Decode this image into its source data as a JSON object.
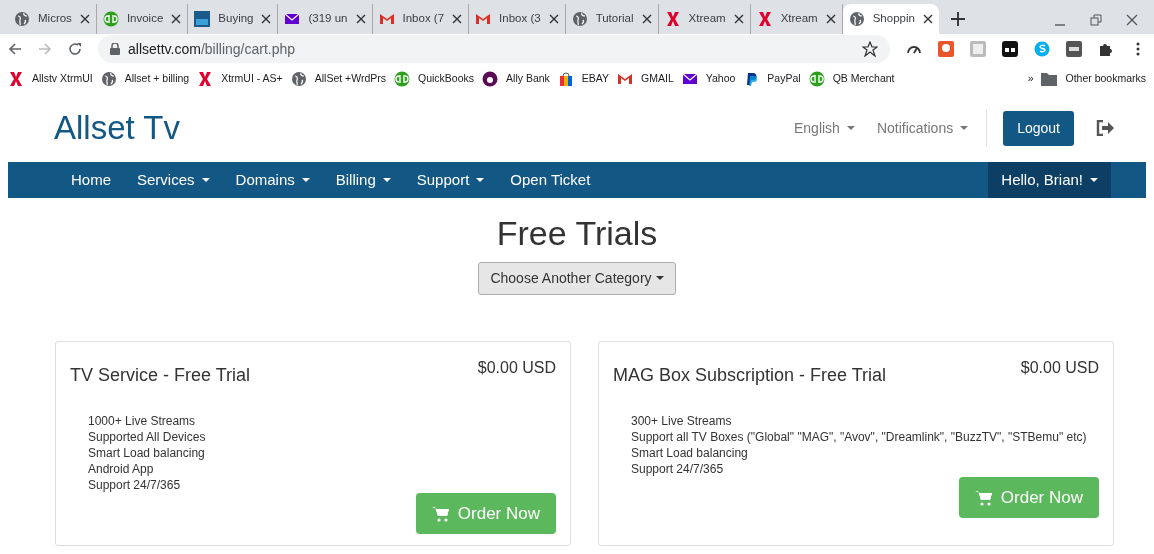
{
  "browser": {
    "tabs": [
      {
        "title": "Micros",
        "kind": "globe",
        "selected": false
      },
      {
        "title": "Invoice",
        "kind": "qb",
        "selected": false
      },
      {
        "title": "Buying",
        "kind": "sa",
        "selected": false
      },
      {
        "title": "(319 un",
        "kind": "mail",
        "selected": false
      },
      {
        "title": "Inbox (7",
        "kind": "gmail",
        "selected": false
      },
      {
        "title": "Inbox (3",
        "kind": "gmail",
        "selected": false
      },
      {
        "title": "Tutorial",
        "kind": "globe",
        "selected": false
      },
      {
        "title": "Xtream",
        "kind": "x",
        "selected": false
      },
      {
        "title": "Xtream",
        "kind": "x",
        "selected": false
      },
      {
        "title": "Shoppin",
        "kind": "globe",
        "selected": true
      }
    ],
    "url_domain": "allsettv.com",
    "url_path": "/billing/cart.php",
    "bookmarks": [
      {
        "label": "Allstv XtrmUI",
        "kind": "x"
      },
      {
        "label": "Allset + billing",
        "kind": "globe"
      },
      {
        "label": "XtrmUI - AS+",
        "kind": "x"
      },
      {
        "label": "AllSet +WrdPrs",
        "kind": "globe"
      },
      {
        "label": "QuickBooks",
        "kind": "qb"
      },
      {
        "label": "Ally Bank",
        "kind": "ally"
      },
      {
        "label": "EBAY",
        "kind": "bag"
      },
      {
        "label": "GMAIL",
        "kind": "gmail"
      },
      {
        "label": "Yahoo",
        "kind": "mail"
      },
      {
        "label": "PayPal",
        "kind": "paypal"
      },
      {
        "label": "QB Merchant",
        "kind": "qb"
      }
    ],
    "bookmarks_more": "»",
    "other_bookmarks": "Other bookmarks"
  },
  "header": {
    "logo": "Allset Tv",
    "language": "English",
    "notifications": "Notifications",
    "logout": "Logout"
  },
  "nav": {
    "items": [
      {
        "label": "Home",
        "dropdown": false
      },
      {
        "label": "Services",
        "dropdown": true
      },
      {
        "label": "Domains",
        "dropdown": true
      },
      {
        "label": "Billing",
        "dropdown": true
      },
      {
        "label": "Support",
        "dropdown": true
      },
      {
        "label": "Open Ticket",
        "dropdown": false
      }
    ],
    "user": "Hello, Brian!"
  },
  "page": {
    "title": "Free Trials",
    "category_button": "Choose Another Category",
    "products": [
      {
        "name": "TV Service - Free Trial",
        "price": "$0.00 USD",
        "features": [
          "1000+ Live Streams",
          "Supported All Devices",
          "Smart Load balancing",
          "Android App",
          "Support 24/7/365"
        ],
        "button": "Order Now"
      },
      {
        "name": "MAG Box Subscription - Free Trial",
        "price": "$0.00 USD",
        "features": [
          "300+ Live Streams",
          "Support all TV Boxes (\"Global\" \"MAG\", \"Avov\", \"Dreamlink\", \"BuzzTV\", \"STBemu\" etc)",
          "Smart Load balancing",
          "Support 24/7/365"
        ],
        "button": "Order Now"
      }
    ]
  }
}
